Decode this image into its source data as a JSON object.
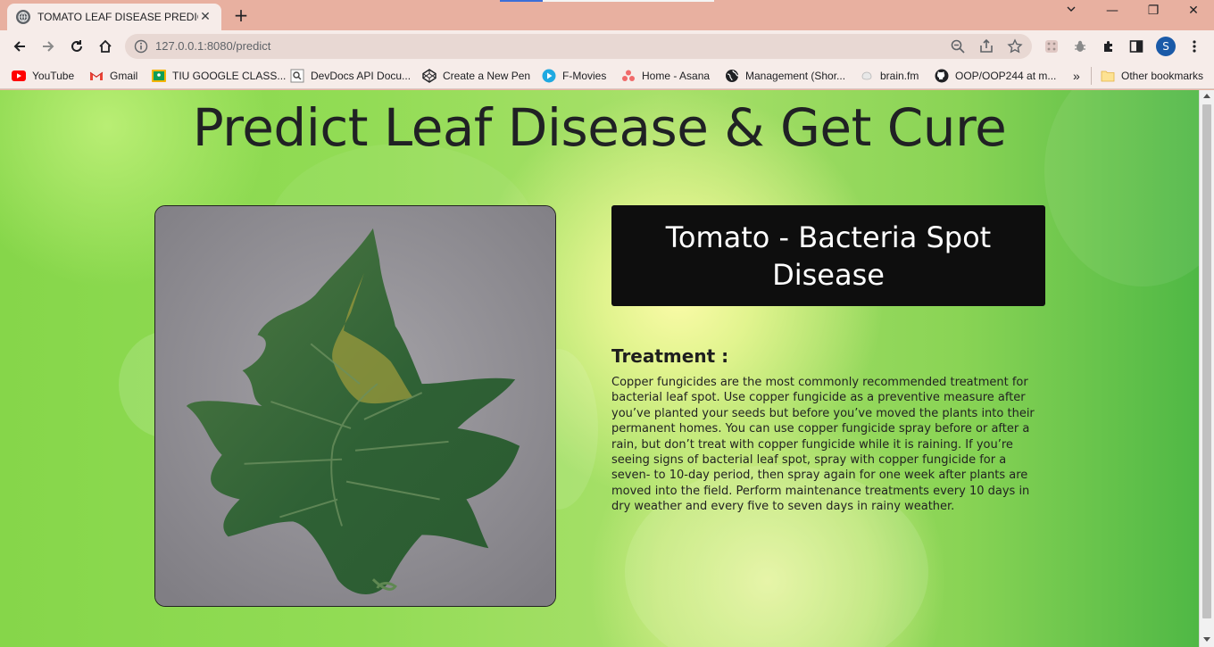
{
  "browser": {
    "tab_title": "TOMATO LEAF DISEASE PREDICTION",
    "tab_close": "✕",
    "new_tab": "+",
    "window_controls": {
      "minimize": "—",
      "restore": "❐",
      "close": "✕"
    },
    "url": "127.0.0.1:8080/predict",
    "profile_initial": "S",
    "bookmarks": [
      {
        "label": "YouTube",
        "icon": "youtube-icon"
      },
      {
        "label": "Gmail",
        "icon": "gmail-icon"
      },
      {
        "label": "TIU GOOGLE CLASS...",
        "icon": "google-classroom-icon"
      },
      {
        "label": "DevDocs API Docu...",
        "icon": "devdocs-icon"
      },
      {
        "label": "Create a New Pen",
        "icon": "codepen-icon"
      },
      {
        "label": "F-Movies",
        "icon": "play-icon"
      },
      {
        "label": "Home - Asana",
        "icon": "asana-icon"
      },
      {
        "label": "Management (Shor...",
        "icon": "globe-icon"
      },
      {
        "label": "brain.fm",
        "icon": "brainfm-icon"
      },
      {
        "label": "OOP/OOP244 at m...",
        "icon": "github-icon"
      }
    ],
    "bookmarks_overflow": "»",
    "other_bookmarks": "Other bookmarks"
  },
  "page": {
    "heading": "Predict Leaf Disease & Get Cure",
    "result": "Tomato - Bacteria Spot Disease",
    "treatment_title": "Treatment :",
    "treatment_text": "Copper fungicides are the most commonly recommended treatment for bacterial leaf spot. Use copper fungicide as a preventive measure after you’ve planted your seeds but before you’ve moved the plants into their permanent homes. You can use copper fungicide spray before or after a rain, but don’t treat with copper fungicide while it is raining. If you’re seeing signs of bacterial leaf spot, spray with copper fungicide for a seven- to 10-day period, then spray again for one week after plants are moved into the field. Perform maintenance treatments every 10 days in dry weather and every five to seven days in rainy weather.",
    "image_subject": "uploaded-tomato-leaf-image"
  }
}
